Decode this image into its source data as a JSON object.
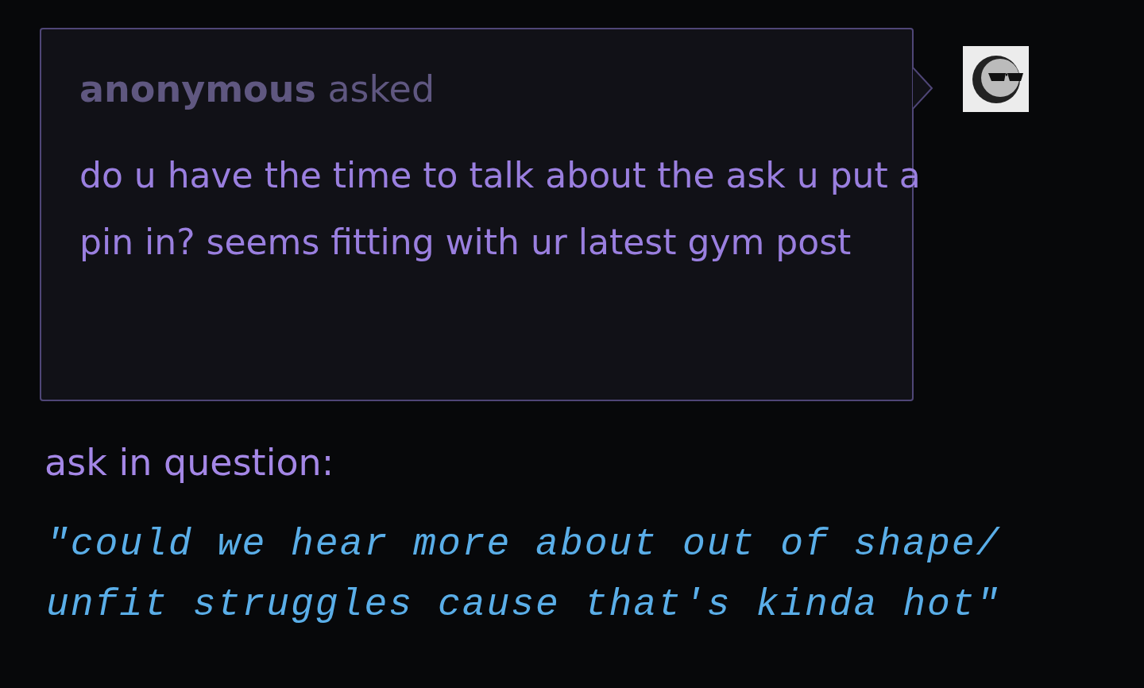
{
  "ask": {
    "asker": "anonymous",
    "verb": "asked",
    "question": "do u have the time to talk about the ask u put a pin in? seems fitting with ur latest gym post"
  },
  "answer": {
    "intro": "ask in question:",
    "quote_lines": [
      "\"could we hear more about out of shape/",
      "unfit struggles cause that's kinda hot\""
    ]
  }
}
